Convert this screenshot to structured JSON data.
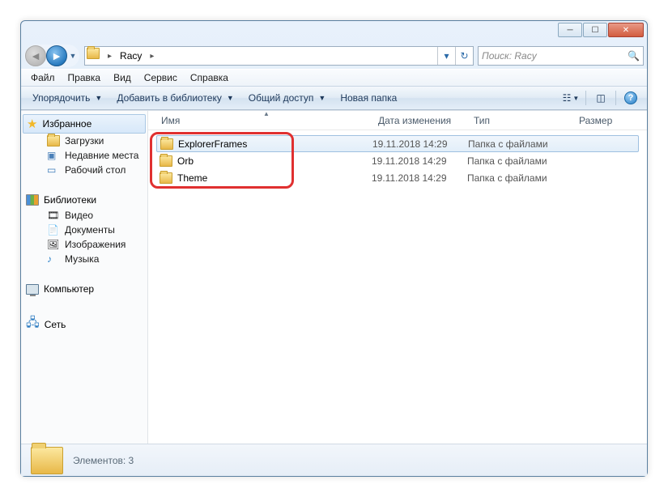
{
  "breadcrumb": {
    "folder": "Racy"
  },
  "search": {
    "placeholder": "Поиск: Racy"
  },
  "menu": {
    "file": "Файл",
    "edit": "Правка",
    "view": "Вид",
    "tools": "Сервис",
    "help": "Справка"
  },
  "toolbar": {
    "organize": "Упорядочить",
    "add_library": "Добавить в библиотеку",
    "share": "Общий доступ",
    "new_folder": "Новая папка"
  },
  "nav": {
    "favorites": "Избранное",
    "downloads": "Загрузки",
    "recent": "Недавние места",
    "desktop": "Рабочий стол",
    "libraries": "Библиотеки",
    "video": "Видео",
    "documents": "Документы",
    "pictures": "Изображения",
    "music": "Музыка",
    "computer": "Компьютер",
    "network": "Сеть"
  },
  "columns": {
    "name": "Имя",
    "date": "Дата изменения",
    "type": "Тип",
    "size": "Размер"
  },
  "files": [
    {
      "name": "ExplorerFrames",
      "date": "19.11.2018 14:29",
      "type": "Папка с файлами"
    },
    {
      "name": "Orb",
      "date": "19.11.2018 14:29",
      "type": "Папка с файлами"
    },
    {
      "name": "Theme",
      "date": "19.11.2018 14:29",
      "type": "Папка с файлами"
    }
  ],
  "status": {
    "count_text": "Элементов: 3"
  }
}
